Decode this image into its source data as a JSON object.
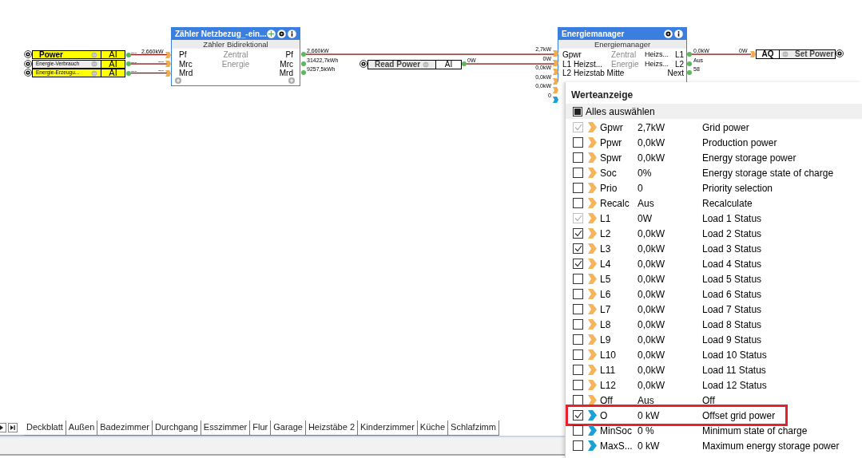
{
  "left_inputs": [
    {
      "label": "Power",
      "io": "AI",
      "highlighted": true,
      "source_value": "---",
      "target_value": "2,660kW"
    },
    {
      "label": "Energie-Verbrauch",
      "io": "AI",
      "highlighted": false,
      "source_value": "---",
      "target_value": "---"
    },
    {
      "label": "Energie-Erzeugu...",
      "io": "AI",
      "highlighted": true,
      "source_value": "---",
      "target_value": "---"
    }
  ],
  "counter_block": {
    "title": "Zähler Netzbezug_-ein...",
    "subtitle": "Zähler Bidirektional",
    "inputs": [
      "Pf",
      "Mrc",
      "Mrd"
    ],
    "center": [
      "Zentral",
      "Energie"
    ],
    "outputs": [
      "Pf",
      "Mrc",
      "Mrd"
    ],
    "output_values": [
      "2,660kW",
      "31422,7kWh",
      "9257,5kWh"
    ]
  },
  "read_power": {
    "label": "Read Power",
    "io": "AI",
    "wire_value": "0W"
  },
  "energy_manager": {
    "title": "Energiemanager",
    "subtitle": "Energiemanager",
    "input_values": [
      {
        "text": "2,7kW",
        "kind": "input"
      },
      {
        "text": "0W",
        "kind": "input"
      },
      {
        "text": "0,0kW",
        "kind": "input"
      },
      {
        "text": "0,0kW",
        "kind": "input"
      },
      {
        "text": "0,0kW",
        "kind": "input"
      },
      {
        "text": "0",
        "kind": "parameter"
      }
    ],
    "rows": [
      {
        "input": "Gpwr",
        "center": "Zentral",
        "label": "Heizs...",
        "output": "L1"
      },
      {
        "input": "L1 Heizst...",
        "center": "Energie",
        "label": "Heizs...",
        "output": "L2"
      },
      {
        "input": "L2 Heizstab Mitte",
        "output": "Next"
      }
    ],
    "output_values": [
      "0,0kW",
      "Aus",
      "58"
    ]
  },
  "set_power": {
    "io": "AQ",
    "label": "Set Power",
    "wire_value": "0W"
  },
  "value_panel": {
    "title": "Werteanzeige",
    "select_all": {
      "label": "Alles auswählen",
      "indeterminate": true
    },
    "rows": [
      {
        "kind": "input",
        "name": "Gpwr",
        "value": "2,7kW",
        "description": "Grid power",
        "checked": true,
        "disabled": true,
        "highlighted": false
      },
      {
        "kind": "input",
        "name": "Ppwr",
        "value": "0,0kW",
        "description": "Production power",
        "checked": false,
        "disabled": false,
        "highlighted": false
      },
      {
        "kind": "input",
        "name": "Spwr",
        "value": "0,0kW",
        "description": "Energy storage power",
        "checked": false,
        "disabled": false,
        "highlighted": false
      },
      {
        "kind": "input",
        "name": "Soc",
        "value": "0%",
        "description": "Energy storage state of charge",
        "checked": false,
        "disabled": false,
        "highlighted": false
      },
      {
        "kind": "input",
        "name": "Prio",
        "value": "0",
        "description": "Priority selection",
        "checked": false,
        "disabled": false,
        "highlighted": false
      },
      {
        "kind": "input",
        "name": "Recalc",
        "value": "Aus",
        "description": "Recalculate",
        "checked": false,
        "disabled": false,
        "highlighted": false
      },
      {
        "kind": "input",
        "name": "L1",
        "value": "0W",
        "description": "Load 1 Status",
        "checked": true,
        "disabled": true,
        "highlighted": false
      },
      {
        "kind": "input",
        "name": "L2",
        "value": "0,0kW",
        "description": "Load 2 Status",
        "checked": true,
        "disabled": false,
        "highlighted": false
      },
      {
        "kind": "input",
        "name": "L3",
        "value": "0,0kW",
        "description": "Load 3 Status",
        "checked": true,
        "disabled": false,
        "highlighted": false
      },
      {
        "kind": "input",
        "name": "L4",
        "value": "0,0kW",
        "description": "Load 4 Status",
        "checked": true,
        "disabled": false,
        "highlighted": false
      },
      {
        "kind": "input",
        "name": "L5",
        "value": "0,0kW",
        "description": "Load 5 Status",
        "checked": false,
        "disabled": false,
        "highlighted": false
      },
      {
        "kind": "input",
        "name": "L6",
        "value": "0,0kW",
        "description": "Load 6 Status",
        "checked": false,
        "disabled": false,
        "highlighted": false
      },
      {
        "kind": "input",
        "name": "L7",
        "value": "0,0kW",
        "description": "Load 7 Status",
        "checked": false,
        "disabled": false,
        "highlighted": false
      },
      {
        "kind": "input",
        "name": "L8",
        "value": "0,0kW",
        "description": "Load 8 Status",
        "checked": false,
        "disabled": false,
        "highlighted": false
      },
      {
        "kind": "input",
        "name": "L9",
        "value": "0,0kW",
        "description": "Load 9 Status",
        "checked": false,
        "disabled": false,
        "highlighted": false
      },
      {
        "kind": "input",
        "name": "L10",
        "value": "0,0kW",
        "description": "Load 10 Status",
        "checked": false,
        "disabled": false,
        "highlighted": false
      },
      {
        "kind": "input",
        "name": "L11",
        "value": "0,0kW",
        "description": "Load 11 Status",
        "checked": false,
        "disabled": false,
        "highlighted": false
      },
      {
        "kind": "input",
        "name": "L12",
        "value": "0,0kW",
        "description": "Load 12 Status",
        "checked": false,
        "disabled": false,
        "highlighted": false
      },
      {
        "kind": "input",
        "name": "Off",
        "value": "Aus",
        "description": "Off",
        "checked": false,
        "disabled": false,
        "highlighted": false
      },
      {
        "kind": "parameter",
        "name": "O",
        "value": "0 kW",
        "description": "Offset grid power",
        "checked": true,
        "disabled": false,
        "highlighted": true
      },
      {
        "kind": "parameter",
        "name": "MinSoc",
        "value": "0 %",
        "description": "Minimum state of charge",
        "checked": false,
        "disabled": false,
        "highlighted": false
      },
      {
        "kind": "parameter",
        "name": "MaxS...",
        "value": "0 kW",
        "description": "Maximum energy storage power",
        "checked": false,
        "disabled": false,
        "highlighted": false
      }
    ]
  },
  "sheet_tabs": [
    "Deckblatt",
    "Außen",
    "Badezimmer",
    "Durchgang",
    "Esszimmer",
    "Flur",
    "Garage",
    "Heizstäbe 2",
    "Kinderzimmer",
    "Küche",
    "Schlafzimm"
  ]
}
